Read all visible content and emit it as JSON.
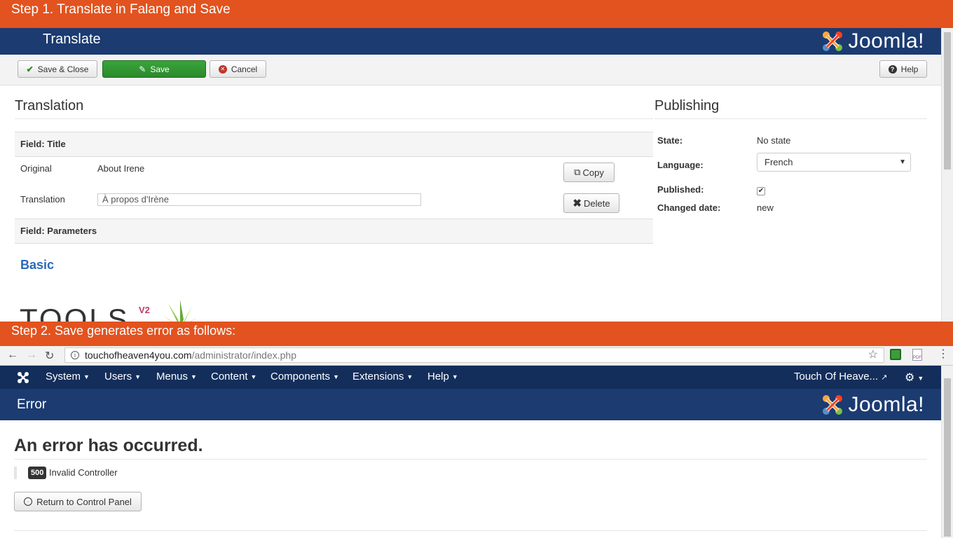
{
  "step1": {
    "text": "Step 1. Translate in Falang and Save"
  },
  "step2": {
    "text": "Step 2. Save generates error as follows:"
  },
  "panel1": {
    "title": "Translate",
    "toolbar": {
      "save_close": "Save & Close",
      "save": "Save",
      "cancel": "Cancel",
      "help": "Help"
    },
    "translation": {
      "heading": "Translation",
      "field_title": "Field: Title",
      "original_label": "Original",
      "original_value": "About Irene",
      "translation_label": "Translation",
      "translation_value": "À propos d'Irène",
      "copy": "Copy",
      "delete": "Delete",
      "field_params": "Field: Parameters",
      "basic": "Basic"
    },
    "publishing": {
      "heading": "Publishing",
      "state_label": "State:",
      "state_value": "No state",
      "language_label": "Language:",
      "language_value": "French",
      "published_label": "Published:",
      "changed_label": "Changed date:",
      "changed_value": "new"
    },
    "tools_logo": {
      "text": "TOOLS",
      "version": "V2"
    }
  },
  "browser": {
    "url_domain": "touchofheaven4you.com",
    "url_path": "/administrator/index.php"
  },
  "adminbar": {
    "menu": [
      "System",
      "Users",
      "Menus",
      "Content",
      "Components",
      "Extensions",
      "Help"
    ],
    "site_name": "Touch Of Heave..."
  },
  "panel2": {
    "title": "Error",
    "heading": "An error has occurred.",
    "code": "500",
    "message": "Invalid Controller",
    "return_button": "Return to Control Panel"
  },
  "brand": {
    "logo_text": "Joomla!",
    "accent": "#e2531f",
    "header_blue": "#1b3b71",
    "menu_navy": "#132e5b"
  }
}
